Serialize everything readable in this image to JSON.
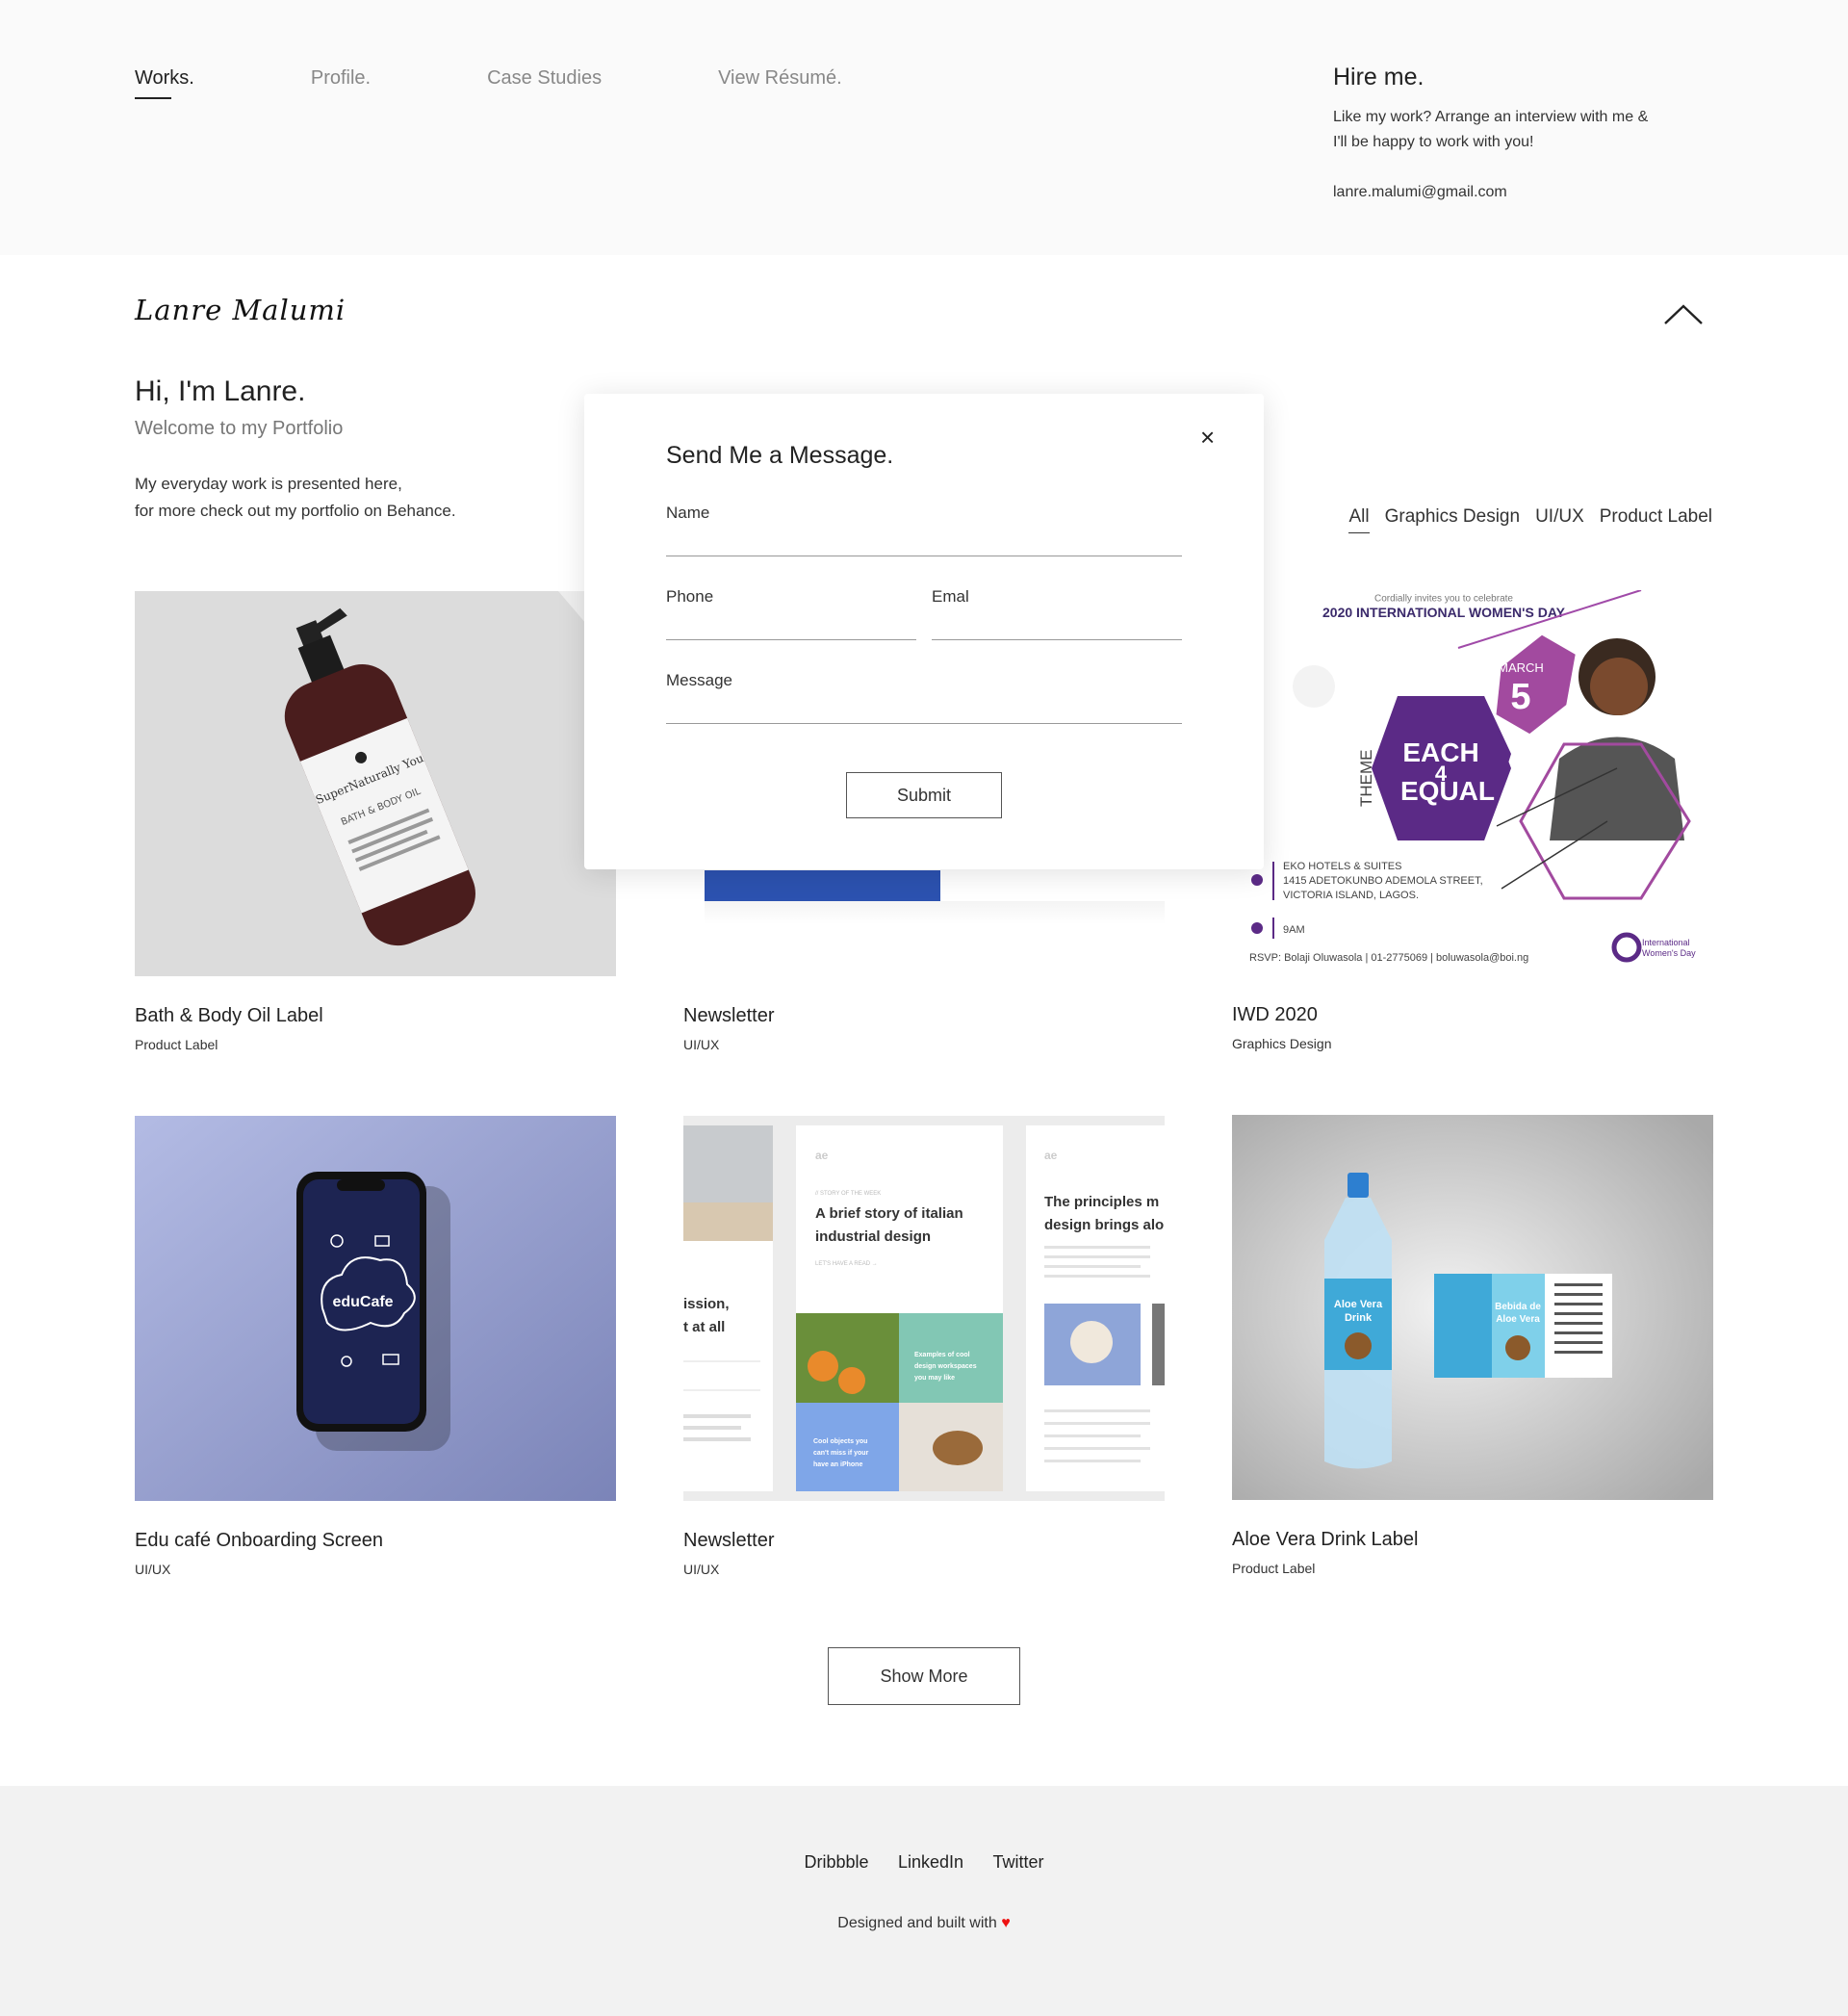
{
  "nav": {
    "works": "Works.",
    "profile": "Profile.",
    "case_studies": "Case Studies",
    "resume": "View Résumé."
  },
  "hire": {
    "title": "Hire me.",
    "text_line1": "Like my work? Arrange an interview with me &",
    "text_line2": "I'll be happy to work with you!",
    "email": "lanre.malumi@gmail.com"
  },
  "brand": {
    "logo": "Lanre Malumi"
  },
  "intro": {
    "greeting": "Hi, I'm Lanre.",
    "subtitle": "Welcome to my Portfolio",
    "desc_line1": "My everyday work is presented here,",
    "desc_line2": "for more check out my portfolio on Behance."
  },
  "filters": [
    "All",
    "Graphics Design",
    "UI/UX",
    "Product Label"
  ],
  "projects": [
    {
      "title": "Bath & Body Oil Label",
      "category": "Product Label"
    },
    {
      "title": "Newsletter",
      "category": "UI/UX"
    },
    {
      "title": "IWD 2020",
      "category": "Graphics Design"
    },
    {
      "title": "Edu café Onboarding Screen",
      "category": "UI/UX"
    },
    {
      "title": "Newsletter",
      "category": "UI/UX"
    },
    {
      "title": "Aloe Vera Drink Label",
      "category": "Product Label"
    }
  ],
  "thumbs": {
    "bath": {
      "brand": "SuperNaturally You",
      "line2": "BATH & BODY OIL"
    },
    "iwd": {
      "invite": "Cordially invites you to celebrate",
      "heading": "2020 INTERNATIONAL WOMEN'S DAY",
      "month": "MARCH",
      "day": "5",
      "theme": "THEME",
      "each": "EACH",
      "four": "4",
      "equal": "EQUAL",
      "venue1": "EKO HOTELS & SUITES",
      "venue2": "1415 ADETOKUNBO ADEMOLA STREET,",
      "venue3": "VICTORIA ISLAND, LAGOS.",
      "time": "9AM",
      "rsvp": "RSVP: Bolaji Oluwasola | 01-2775069 | boluwasola@boi.ng",
      "org1": "International",
      "org2": "Women's Day"
    },
    "edu": {
      "app": "eduCafe"
    },
    "news2": {
      "ae": "ae",
      "ae2": "ae",
      "kicker": "// STORY OF THE WEEK",
      "head1": "A brief story of italian",
      "head2": "industrial design",
      "cta": "LET'S HAVE A READ →",
      "side1": "ission,",
      "side2": "t at all",
      "r1": "The principles m",
      "r2": "design brings alo",
      "t1": "Examples of cool",
      "t2": "design workspaces",
      "t3": "you may like",
      "t4": "Cool objects you",
      "t5": "can't miss if your",
      "t6": "have an iPhone"
    },
    "aloe": {
      "bottle1": "Aloe Vera",
      "bottle2": "Drink",
      "label1": "Bebida de",
      "label2": "Aloe Vera"
    }
  },
  "show_more": "Show More",
  "footer": {
    "links": [
      "Dribbble",
      "LinkedIn",
      "Twitter"
    ],
    "credit": "Designed and built with",
    "heart": "♥"
  },
  "modal": {
    "title": "Send Me a Message.",
    "close": "×",
    "name_label": "Name",
    "phone_label": "Phone",
    "email_label": "Emal",
    "message_label": "Message",
    "submit": "Submit"
  },
  "icons": {
    "close": "close-icon",
    "collapse": "chevron-up-icon",
    "heart": "heart-icon"
  },
  "colors": {
    "accent_purple": "#5b2a86",
    "newsletter_blue": "#2c52b0",
    "heart": "#e11111"
  }
}
